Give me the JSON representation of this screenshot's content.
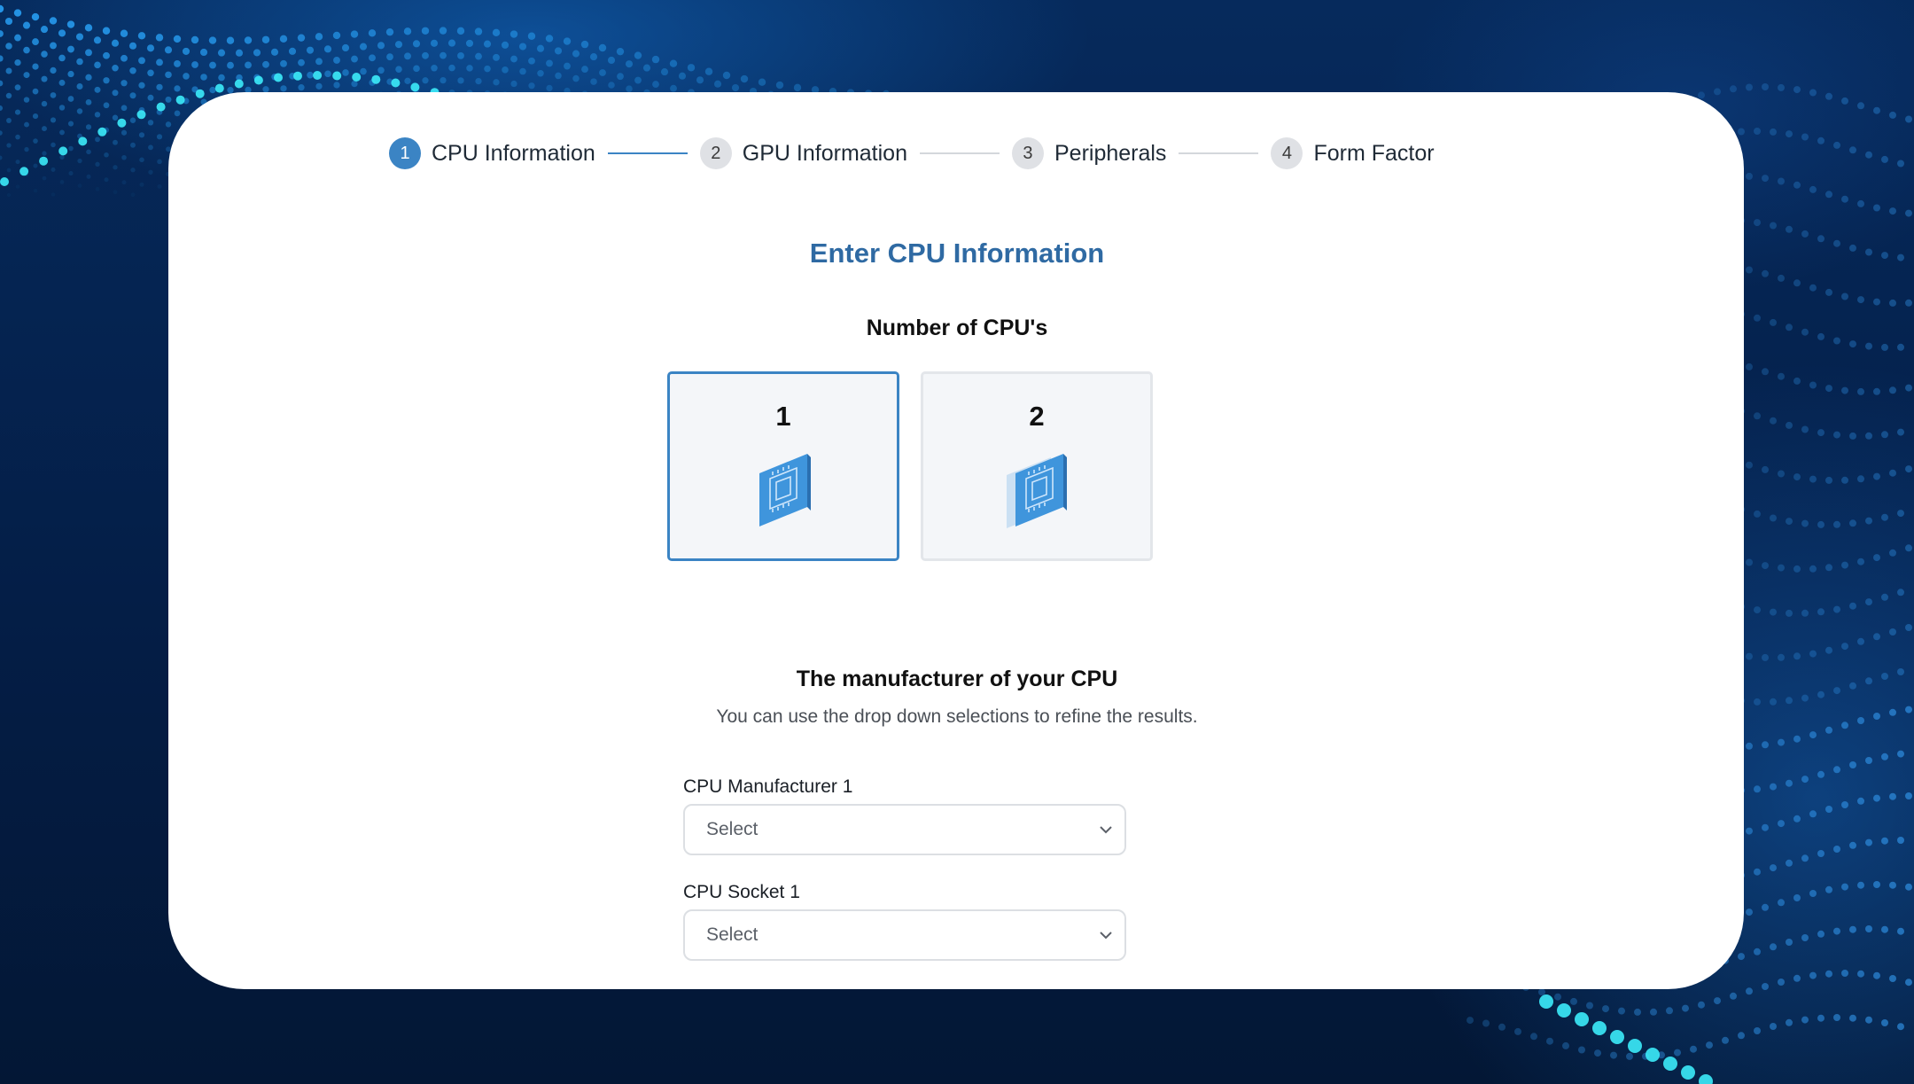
{
  "stepper": {
    "steps": [
      {
        "number": "1",
        "label": "CPU Information",
        "active": true
      },
      {
        "number": "2",
        "label": "GPU Information",
        "active": false
      },
      {
        "number": "3",
        "label": "Peripherals",
        "active": false
      },
      {
        "number": "4",
        "label": "Form Factor",
        "active": false
      }
    ]
  },
  "main": {
    "title": "Enter CPU Information",
    "cpu_count_heading": "Number of CPU's",
    "cpu_options": [
      {
        "count": "1",
        "selected": true,
        "icon": "cpu-chip-icon"
      },
      {
        "count": "2",
        "selected": false,
        "icon": "dual-cpu-chip-icon"
      }
    ],
    "manufacturer_heading": "The manufacturer of your CPU",
    "manufacturer_description": "You can use the drop down selections to refine the results.",
    "fields": [
      {
        "label": "CPU Manufacturer 1",
        "value": "Select"
      },
      {
        "label": "CPU Socket 1",
        "value": "Select"
      }
    ]
  },
  "colors": {
    "accent": "#3b84c4",
    "title": "#2f6aa3",
    "background": "#05224f"
  }
}
